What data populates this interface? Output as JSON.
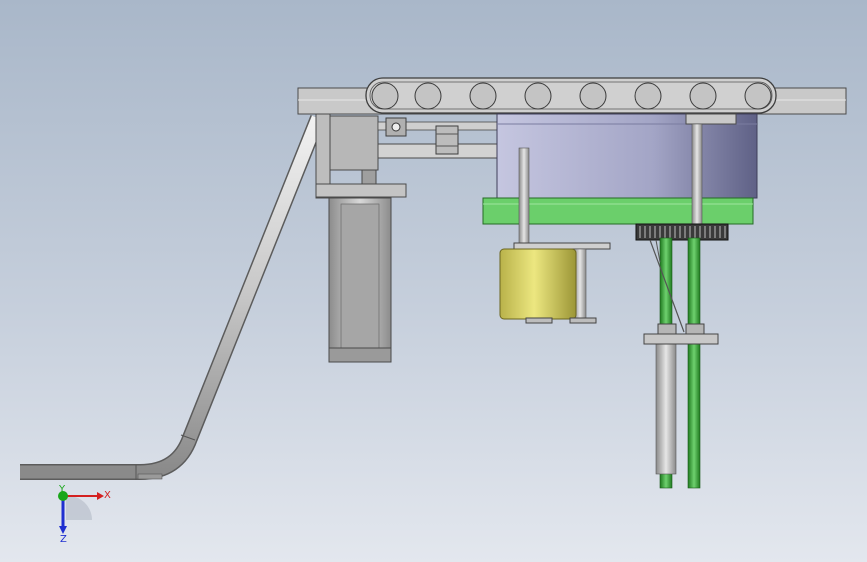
{
  "triad": {
    "x_label": "X",
    "y_label": "Y",
    "z_label": "Z",
    "x_color": "#d42020",
    "y_color": "#1aa61a",
    "z_color": "#1f2fd0"
  },
  "colors": {
    "steel_light": "#dcdcdc",
    "steel_mid": "#b5b5b5",
    "steel_dark": "#6e6e6e",
    "drum": "#a9abcc",
    "green_plate": "#6ccf6c",
    "green_rod": "#35a435",
    "motor_yellow": "#d9d46a"
  },
  "icons": [
    "coordinate-triad-icon"
  ]
}
